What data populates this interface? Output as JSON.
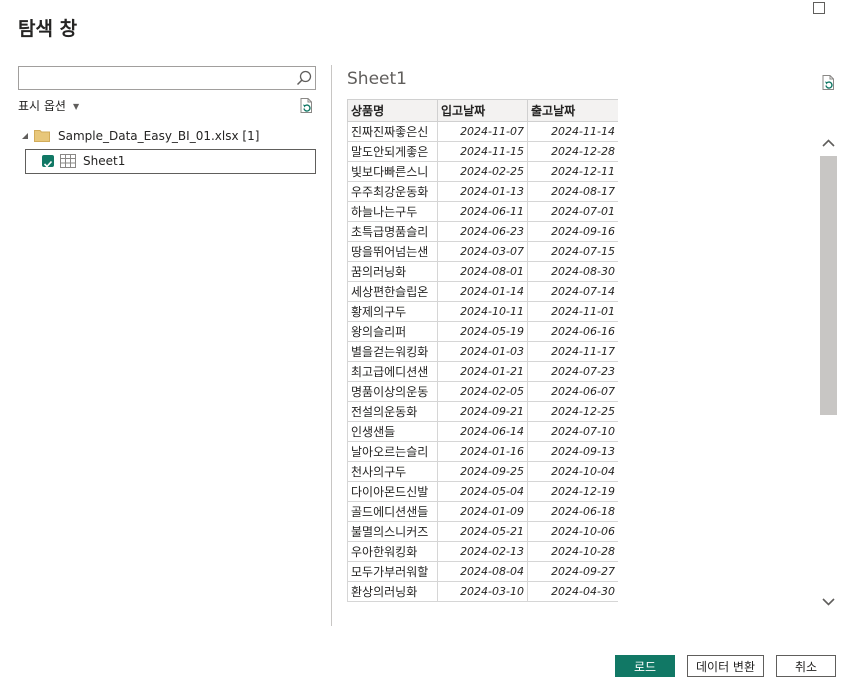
{
  "window": {
    "title": "탐색 창"
  },
  "search": {
    "value": "",
    "placeholder": ""
  },
  "display_options": {
    "label": "표시 옵션"
  },
  "tree": {
    "file_label": "Sample_Data_Easy_BI_01.xlsx [1]",
    "sheet_label": "Sheet1",
    "sheet_checked": true
  },
  "preview": {
    "title": "Sheet1",
    "columns": [
      "상품명",
      "입고날짜",
      "출고날짜"
    ],
    "rows": [
      [
        "진짜진짜좋은신",
        "2024-11-07",
        "2024-11-14"
      ],
      [
        "말도안되게좋은",
        "2024-11-15",
        "2024-12-28"
      ],
      [
        "빛보다빠른스니",
        "2024-02-25",
        "2024-12-11"
      ],
      [
        "우주최강운동화",
        "2024-01-13",
        "2024-08-17"
      ],
      [
        "하늘나는구두",
        "2024-06-11",
        "2024-07-01"
      ],
      [
        "초특급명품슬리",
        "2024-06-23",
        "2024-09-16"
      ],
      [
        "땅을뛰어넘는샌",
        "2024-03-07",
        "2024-07-15"
      ],
      [
        "꿈의러닝화",
        "2024-08-01",
        "2024-08-30"
      ],
      [
        "세상편한슬립온",
        "2024-01-14",
        "2024-07-14"
      ],
      [
        "황제의구두",
        "2024-10-11",
        "2024-11-01"
      ],
      [
        "왕의슬리퍼",
        "2024-05-19",
        "2024-06-16"
      ],
      [
        "별을걷는워킹화",
        "2024-01-03",
        "2024-11-17"
      ],
      [
        "최고급에디션샌",
        "2024-01-21",
        "2024-07-23"
      ],
      [
        "명품이상의운동",
        "2024-02-05",
        "2024-06-07"
      ],
      [
        "전설의운동화",
        "2024-09-21",
        "2024-12-25"
      ],
      [
        "인생샌들",
        "2024-06-14",
        "2024-07-10"
      ],
      [
        "날아오르는슬리",
        "2024-01-16",
        "2024-09-13"
      ],
      [
        "천사의구두",
        "2024-09-25",
        "2024-10-04"
      ],
      [
        "다이아몬드신발",
        "2024-05-04",
        "2024-12-19"
      ],
      [
        "골드에디션샌들",
        "2024-01-09",
        "2024-06-18"
      ],
      [
        "불멸의스니커즈",
        "2024-05-21",
        "2024-10-06"
      ],
      [
        "우아한워킹화",
        "2024-02-13",
        "2024-10-28"
      ],
      [
        "모두가부러워할",
        "2024-08-04",
        "2024-09-27"
      ],
      [
        "환상의러닝화",
        "2024-03-10",
        "2024-04-30"
      ]
    ]
  },
  "buttons": {
    "load": "로드",
    "transform": "데이터 변환",
    "cancel": "취소"
  },
  "colors": {
    "accent": "#117865",
    "border": "#605e5c",
    "header_bg": "#f3f2f1"
  },
  "icons": [
    "maximize-icon",
    "search-icon",
    "refresh-icon",
    "folder-icon",
    "table-grid-icon",
    "checkbox-icon",
    "chevron-up-icon",
    "chevron-down-icon"
  ]
}
